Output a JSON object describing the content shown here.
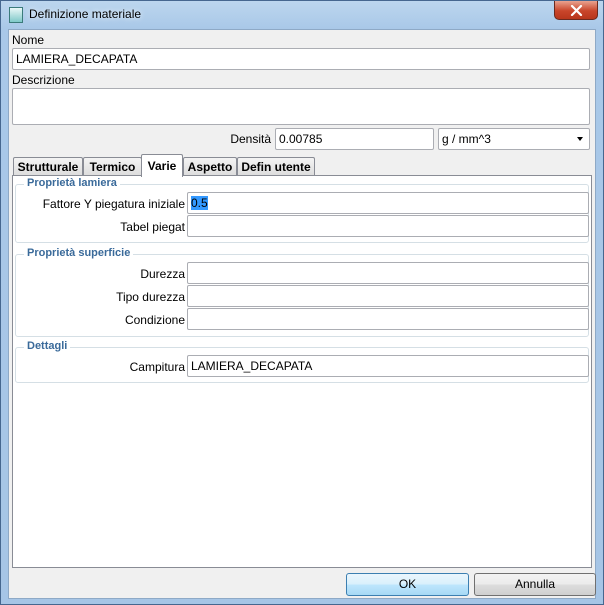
{
  "window": {
    "title": "Definizione materiale"
  },
  "nome": {
    "label": "Nome",
    "value": "LAMIERA_DECAPATA"
  },
  "descrizione": {
    "label": "Descrizione",
    "value": ""
  },
  "densita": {
    "label": "Densità",
    "value": "0.00785",
    "unit": "g / mm^3"
  },
  "tabs": [
    {
      "label": "Strutturale"
    },
    {
      "label": "Termico"
    },
    {
      "label": "Varie"
    },
    {
      "label": "Aspetto"
    },
    {
      "label": "Defin utente"
    }
  ],
  "groups": {
    "lamiera": {
      "title": "Proprietà lamiera",
      "fattore_y": {
        "label": "Fattore Y piegatura iniziale",
        "value": "0.5"
      },
      "tabel_piegat": {
        "label": "Tabel piegat",
        "value": ""
      }
    },
    "superficie": {
      "title": "Proprietà superficie",
      "durezza": {
        "label": "Durezza",
        "value": ""
      },
      "tipo_durezza": {
        "label": "Tipo durezza",
        "value": ""
      },
      "condizione": {
        "label": "Condizione",
        "value": ""
      }
    },
    "dettagli": {
      "title": "Dettagli",
      "campitura": {
        "label": "Campitura",
        "value": "LAMIERA_DECAPATA"
      }
    }
  },
  "footer": {
    "ok_label": "OK",
    "cancel_label": "Annulla"
  }
}
